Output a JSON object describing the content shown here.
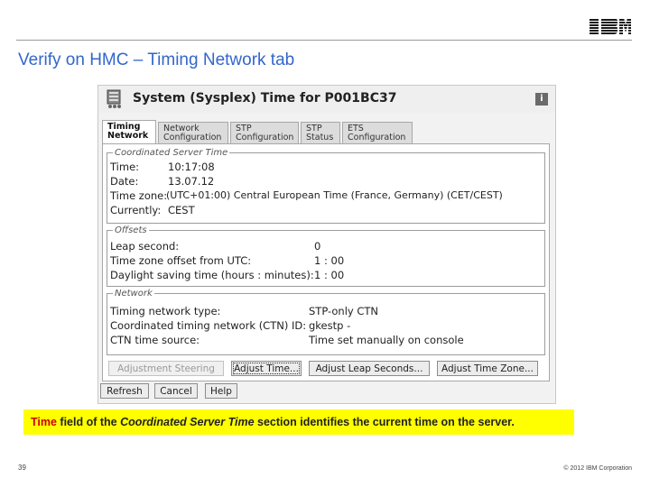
{
  "slide": {
    "logo_text": "IBM",
    "title": "Verify on HMC – Timing Network tab",
    "page_number": "39",
    "copyright": "© 2012 IBM Corporation",
    "caption": {
      "part1": "Time",
      "part2": " field of the ",
      "part3": "Coordinated Server Time",
      "part4": " section identifies the current time on the server."
    }
  },
  "dialog": {
    "title": "System (Sysplex) Time for P001BC37",
    "help_label": "i",
    "tabs": [
      {
        "label": "Timing Network"
      },
      {
        "label": "Network Configuration"
      },
      {
        "label": "STP Configuration"
      },
      {
        "label": "STP Status"
      },
      {
        "label": "ETS Configuration"
      }
    ],
    "cst": {
      "legend": "Coordinated Server Time",
      "time_label": "Time:",
      "time_value": "10:17:08",
      "date_label": "Date:",
      "date_value": "13.07.12",
      "zone_label": "Time zone:",
      "zone_value": "(UTC+01:00) Central European Time (France, Germany) (CET/CEST)",
      "currently_label": "Currently:",
      "currently_value": "CEST"
    },
    "offsets": {
      "legend": "Offsets",
      "leap_label": "Leap second:",
      "leap_value": "0",
      "tz_label": "Time zone offset from UTC:",
      "tz_value": "1 : 00",
      "dst_label": "Daylight saving time (hours : minutes):",
      "dst_value": "1 : 00"
    },
    "network": {
      "legend": "Network",
      "type_label": "Timing network type:",
      "type_value": "STP-only CTN",
      "ctn_label": "Coordinated timing network (CTN) ID:",
      "ctn_value": "gkestp -",
      "source_label": "CTN time source:",
      "source_value": "Time set manually on console"
    },
    "buttons": {
      "adjust_steering": "Adjustment Steering",
      "adjust_time": "Adjust Time...",
      "adjust_leap": "Adjust Leap Seconds...",
      "adjust_zone": "Adjust Time Zone...",
      "refresh": "Refresh",
      "cancel": "Cancel",
      "help": "Help"
    }
  },
  "colors": {
    "title": "#3366cc",
    "caption_bg": "#ffff00",
    "caption_red": "#cc0000"
  }
}
